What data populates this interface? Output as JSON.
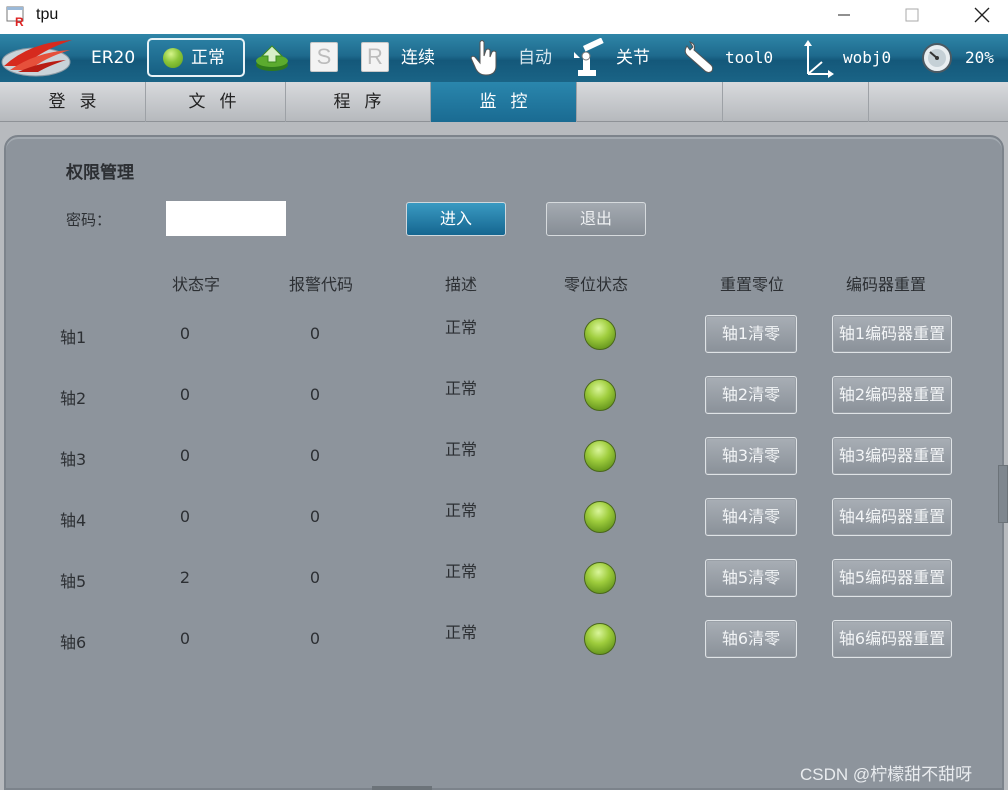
{
  "window": {
    "title": "tpu"
  },
  "toolbar": {
    "robot_name": "ER20",
    "status": "正常",
    "s_label": "S",
    "r_label": "R",
    "run_mode": "连续",
    "control_mode": "自动",
    "coord_mode": "关节",
    "tool": "tool0",
    "wobj": "wobj0",
    "speed": "20%"
  },
  "tabs": [
    "登录",
    "文件",
    "程序",
    "监控",
    "",
    "",
    ""
  ],
  "active_tab": "监控",
  "panel": {
    "title": "权限管理",
    "password_label": "密码：",
    "password_value": "",
    "enter_label": "进入",
    "exit_label": "退出"
  },
  "table": {
    "headers": {
      "status_word": "状态字",
      "alarm_code": "报警代码",
      "description": "描述",
      "zero_status": "零位状态",
      "reset_zero": "重置零位",
      "encoder_reset": "编码器重置"
    },
    "rows": [
      {
        "axis": "轴1",
        "status_word": "0",
        "alarm_code": "0",
        "description": "正常",
        "zero_ok": true,
        "clear_label": "轴1清零",
        "encoder_label": "轴1编码器重置"
      },
      {
        "axis": "轴2",
        "status_word": "0",
        "alarm_code": "0",
        "description": "正常",
        "zero_ok": true,
        "clear_label": "轴2清零",
        "encoder_label": "轴2编码器重置"
      },
      {
        "axis": "轴3",
        "status_word": "0",
        "alarm_code": "0",
        "description": "正常",
        "zero_ok": true,
        "clear_label": "轴3清零",
        "encoder_label": "轴3编码器重置"
      },
      {
        "axis": "轴4",
        "status_word": "0",
        "alarm_code": "0",
        "description": "正常",
        "zero_ok": true,
        "clear_label": "轴4清零",
        "encoder_label": "轴4编码器重置"
      },
      {
        "axis": "轴5",
        "status_word": "2",
        "alarm_code": "0",
        "description": "正常",
        "zero_ok": true,
        "clear_label": "轴5清零",
        "encoder_label": "轴5编码器重置"
      },
      {
        "axis": "轴6",
        "status_word": "0",
        "alarm_code": "0",
        "description": "正常",
        "zero_ok": true,
        "clear_label": "轴6清零",
        "encoder_label": "轴6编码器重置"
      }
    ]
  },
  "watermark": "CSDN @柠檬甜不甜呀",
  "colors": {
    "toolbar_blue": "#1e6a8d",
    "panel_gray": "#8d949c",
    "led_green": "#8cc63a"
  }
}
